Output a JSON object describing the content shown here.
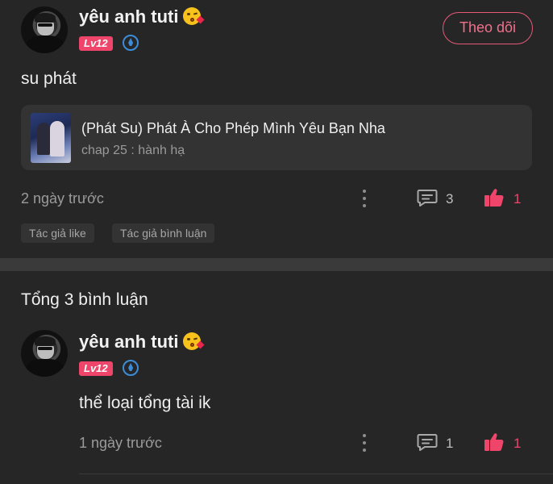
{
  "post": {
    "username": "yêu anh tuti",
    "level": "Lv12",
    "follow_label": "Theo dõi",
    "text": "su phát",
    "card": {
      "title": "(Phát Su) Phát À Cho Phép Mình Yêu Bạn Nha",
      "subtitle": "chap 25 : hành hạ"
    },
    "time": "2 ngày trước",
    "comment_count": "3",
    "like_count": "1",
    "tags": [
      "Tác giả like",
      "Tác giả bình luận"
    ]
  },
  "comments_section": {
    "title": "Tổng 3 bình luận",
    "comments": [
      {
        "username": "yêu anh tuti",
        "level": "Lv12",
        "text": "thể loại tổng tài ik",
        "time": "1 ngày trước",
        "comment_count": "1",
        "like_count": "1"
      }
    ]
  },
  "icons": {
    "emoji": "kissing-face-emoji-icon",
    "badge": "level-badge-icon",
    "more": "more-vertical-icon",
    "comment": "comment-icon",
    "like": "thumbs-up-icon"
  },
  "colors": {
    "background": "#262626",
    "accent": "#f0456a",
    "card": "#333333"
  }
}
